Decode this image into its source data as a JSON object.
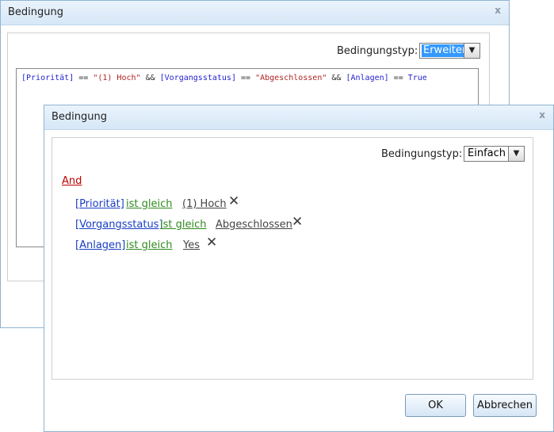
{
  "back_dialog": {
    "title": "Bedingung",
    "close_glyph": "x",
    "type_label": "Bedingungstyp:",
    "type_value": "Erweitert",
    "expression": {
      "field1": "[Priorität]",
      "op1": " == ",
      "val1": "\"(1) Hoch\"",
      "and1": " && ",
      "field2": "[Vorgangsstatus]",
      "op2": " == ",
      "val2": "\"Abgeschlossen\"",
      "and2": " && ",
      "field3": "[Anlagen]",
      "op3": " == ",
      "val3": "True"
    }
  },
  "front_dialog": {
    "title": "Bedingung",
    "close_glyph": "x",
    "type_label": "Bedingungstyp:",
    "type_value": "Einfach",
    "group_operator": "And",
    "conditions": [
      {
        "field": "[Priorität]",
        "operator": "ist gleich",
        "value": "(1) Hoch"
      },
      {
        "field": "[Vorgangsstatus]",
        "operator": "ist gleich",
        "value": "Abgeschlossen"
      },
      {
        "field": "[Anlagen]",
        "operator": "ist gleich",
        "value": "Yes"
      }
    ],
    "delete_glyph": "✕",
    "ok_label": "OK",
    "cancel_label": "Abbrechen"
  },
  "colors": {
    "field": "#1a3dc4",
    "operator": "#2f8a1e",
    "group_operator": "#c00000",
    "selection": "#3399ff"
  },
  "icons": {
    "dropdown": "chevron-down-icon",
    "delete": "close-x-icon",
    "window_close": "close-icon"
  }
}
